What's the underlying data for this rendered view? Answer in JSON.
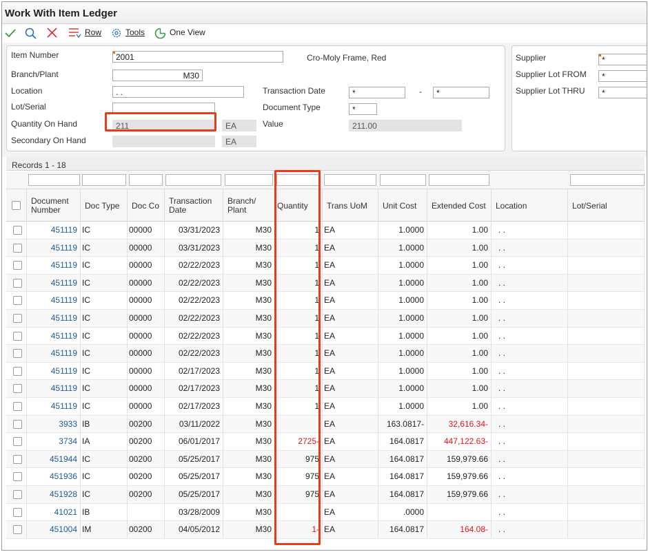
{
  "window": {
    "title": "Work With Item Ledger"
  },
  "toolbar": {
    "row_label": "Row",
    "tools_label": "Tools",
    "oneview_label": "One View"
  },
  "form": {
    "item_number_label": "Item Number",
    "item_number_value": "2001",
    "item_description": "Cro-Moly Frame, Red",
    "branch_plant_label": "Branch/Plant",
    "branch_plant_value": "M30",
    "location_label": "Location",
    "location_value": ". .",
    "lot_serial_label": "Lot/Serial",
    "lot_serial_value": "",
    "qoh_label": "Quantity On Hand",
    "qoh_value": "211",
    "qoh_uom": "EA",
    "secondary_label": "Secondary On Hand",
    "secondary_value": "",
    "secondary_uom": "EA",
    "transaction_date_label": "Transaction Date",
    "transaction_date_from": "*",
    "transaction_date_sep": "-",
    "transaction_date_to": "*",
    "document_type_label": "Document Type",
    "document_type_value": "*",
    "value_label": "Value",
    "value_value": "211.00",
    "supplier_label": "Supplier",
    "supplier_value": "*",
    "supplier_lot_from_label": "Supplier Lot FROM",
    "supplier_lot_from_value": "*",
    "supplier_lot_thru_label": "Supplier Lot THRU",
    "supplier_lot_thru_value": "*"
  },
  "grid": {
    "records_label": "Records 1 - 18",
    "columns": [
      "Document Number",
      "Doc Type",
      "Doc Co",
      "Transaction Date",
      "Branch/ Plant",
      "Quantity",
      "Trans UoM",
      "Unit Cost",
      "Extended Cost",
      "Location",
      "Lot/Serial"
    ],
    "rows": [
      {
        "doc": "451119",
        "type": "IC",
        "co": "00000",
        "date": "03/31/2023",
        "bp": "M30",
        "qty": "1",
        "uom": "EA",
        "unit": "1.0000",
        "ext": "1.00",
        "loc": ". .",
        "lot": "",
        "qty_neg": false,
        "ext_neg": false
      },
      {
        "doc": "451119",
        "type": "IC",
        "co": "00000",
        "date": "03/31/2023",
        "bp": "M30",
        "qty": "1",
        "uom": "EA",
        "unit": "1.0000",
        "ext": "1.00",
        "loc": ". .",
        "lot": "",
        "qty_neg": false,
        "ext_neg": false
      },
      {
        "doc": "451119",
        "type": "IC",
        "co": "00000",
        "date": "02/22/2023",
        "bp": "M30",
        "qty": "1",
        "uom": "EA",
        "unit": "1.0000",
        "ext": "1.00",
        "loc": ". .",
        "lot": "",
        "qty_neg": false,
        "ext_neg": false
      },
      {
        "doc": "451119",
        "type": "IC",
        "co": "00000",
        "date": "02/22/2023",
        "bp": "M30",
        "qty": "1",
        "uom": "EA",
        "unit": "1.0000",
        "ext": "1.00",
        "loc": ". .",
        "lot": "",
        "qty_neg": false,
        "ext_neg": false
      },
      {
        "doc": "451119",
        "type": "IC",
        "co": "00000",
        "date": "02/22/2023",
        "bp": "M30",
        "qty": "1",
        "uom": "EA",
        "unit": "1.0000",
        "ext": "1.00",
        "loc": ". .",
        "lot": "",
        "qty_neg": false,
        "ext_neg": false
      },
      {
        "doc": "451119",
        "type": "IC",
        "co": "00000",
        "date": "02/22/2023",
        "bp": "M30",
        "qty": "1",
        "uom": "EA",
        "unit": "1.0000",
        "ext": "1.00",
        "loc": ". .",
        "lot": "",
        "qty_neg": false,
        "ext_neg": false
      },
      {
        "doc": "451119",
        "type": "IC",
        "co": "00000",
        "date": "02/22/2023",
        "bp": "M30",
        "qty": "1",
        "uom": "EA",
        "unit": "1.0000",
        "ext": "1.00",
        "loc": ". .",
        "lot": "",
        "qty_neg": false,
        "ext_neg": false
      },
      {
        "doc": "451119",
        "type": "IC",
        "co": "00000",
        "date": "02/22/2023",
        "bp": "M30",
        "qty": "1",
        "uom": "EA",
        "unit": "1.0000",
        "ext": "1.00",
        "loc": ". .",
        "lot": "",
        "qty_neg": false,
        "ext_neg": false
      },
      {
        "doc": "451119",
        "type": "IC",
        "co": "00000",
        "date": "02/17/2023",
        "bp": "M30",
        "qty": "1",
        "uom": "EA",
        "unit": "1.0000",
        "ext": "1.00",
        "loc": ". .",
        "lot": "",
        "qty_neg": false,
        "ext_neg": false
      },
      {
        "doc": "451119",
        "type": "IC",
        "co": "00000",
        "date": "02/17/2023",
        "bp": "M30",
        "qty": "1",
        "uom": "EA",
        "unit": "1.0000",
        "ext": "1.00",
        "loc": ". .",
        "lot": "",
        "qty_neg": false,
        "ext_neg": false
      },
      {
        "doc": "451119",
        "type": "IC",
        "co": "00000",
        "date": "02/17/2023",
        "bp": "M30",
        "qty": "1",
        "uom": "EA",
        "unit": "1.0000",
        "ext": "1.00",
        "loc": ". .",
        "lot": "",
        "qty_neg": false,
        "ext_neg": false
      },
      {
        "doc": "3933",
        "type": "IB",
        "co": "00200",
        "date": "03/11/2022",
        "bp": "M30",
        "qty": "",
        "uom": "EA",
        "unit": "163.0817-",
        "ext": "32,616.34-",
        "loc": ". .",
        "lot": "",
        "qty_neg": false,
        "ext_neg": true
      },
      {
        "doc": "3734",
        "type": "IA",
        "co": "00200",
        "date": "06/01/2017",
        "bp": "M30",
        "qty": "2725-",
        "uom": "EA",
        "unit": "164.0817",
        "ext": "447,122.63-",
        "loc": ". .",
        "lot": "",
        "qty_neg": true,
        "ext_neg": true
      },
      {
        "doc": "451944",
        "type": "IC",
        "co": "00200",
        "date": "05/25/2017",
        "bp": "M30",
        "qty": "975",
        "uom": "EA",
        "unit": "164.0817",
        "ext": "159,979.66",
        "loc": ". .",
        "lot": "",
        "qty_neg": false,
        "ext_neg": false
      },
      {
        "doc": "451936",
        "type": "IC",
        "co": "00200",
        "date": "05/25/2017",
        "bp": "M30",
        "qty": "975",
        "uom": "EA",
        "unit": "164.0817",
        "ext": "159,979.66",
        "loc": ". .",
        "lot": "",
        "qty_neg": false,
        "ext_neg": false
      },
      {
        "doc": "451928",
        "type": "IC",
        "co": "00200",
        "date": "05/25/2017",
        "bp": "M30",
        "qty": "975",
        "uom": "EA",
        "unit": "164.0817",
        "ext": "159,979.66",
        "loc": ". .",
        "lot": "",
        "qty_neg": false,
        "ext_neg": false
      },
      {
        "doc": "41021",
        "type": "IB",
        "co": "",
        "date": "03/28/2009",
        "bp": "M30",
        "qty": "",
        "uom": "EA",
        "unit": ".0000",
        "ext": "",
        "loc": ". .",
        "lot": "",
        "qty_neg": false,
        "ext_neg": false
      },
      {
        "doc": "451004",
        "type": "IM",
        "co": "00200",
        "date": "04/05/2012",
        "bp": "M30",
        "qty": "1-",
        "uom": "EA",
        "unit": "164.0817",
        "ext": "164.08-",
        "loc": ". .",
        "lot": "",
        "qty_neg": true,
        "ext_neg": true
      }
    ]
  },
  "colors": {
    "link": "#1d5c9e",
    "negative": "#e1151a",
    "highlight": "#ea3a1a",
    "required": "#ff6600",
    "ok_check": "#3a9b3a",
    "cancel_x": "#d9302a",
    "toolbar_icon": "#2c72b8"
  },
  "icons": {
    "ok": "check-icon",
    "find": "search-icon",
    "cancel": "close-icon",
    "row": "row-menu-icon",
    "tools": "gear-icon",
    "oneview": "oneview-icon"
  }
}
